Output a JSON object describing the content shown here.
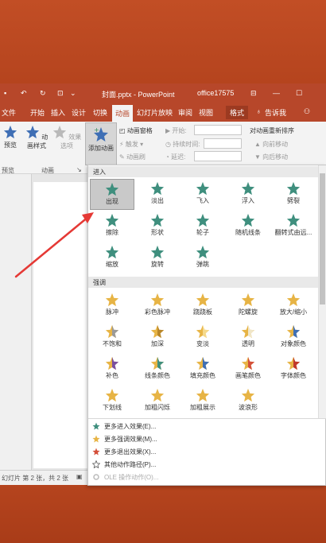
{
  "titlebar": {
    "file": "封面.pptx - PowerPoint",
    "account": "office17575"
  },
  "tabs": [
    "文件",
    "开始",
    "插入",
    "设计",
    "切换",
    "动画",
    "幻灯片放映",
    "审阅",
    "视图",
    "格式"
  ],
  "active_tab": "动画",
  "tell_me": "告诉我",
  "ribbon": {
    "preview": "预览",
    "animation_style": "动画样式",
    "effect_options": "效果选项",
    "add_animation": "添加动画",
    "animation_pane": "动画窗格",
    "trigger": "触发",
    "animation_painter": "动画刷",
    "start": "开始:",
    "duration": "持续时间:",
    "delay": "延迟:",
    "reorder": "对动画重新排序",
    "move_earlier": "向前移动",
    "move_later": "向后移动",
    "group_preview": "预览",
    "group_animation": "动画"
  },
  "gallery": {
    "entrance_header": "进入",
    "emphasis_header": "强调",
    "entrance": [
      "出现",
      "淡出",
      "飞入",
      "浮入",
      "劈裂",
      "擦除",
      "形状",
      "轮子",
      "随机线条",
      "翻转式由远...",
      "缩放",
      "旋转",
      "弹跳"
    ],
    "emphasis": [
      "脉冲",
      "彩色脉冲",
      "跷跷板",
      "陀螺旋",
      "放大/缩小",
      "不饱和",
      "加深",
      "变淡",
      "透明",
      "对象颜色",
      "补色",
      "线条颜色",
      "填充颜色",
      "画笔颜色",
      "字体颜色",
      "下划线",
      "加粗闪烁",
      "加粗展示",
      "波浪形"
    ],
    "more": [
      "更多进入效果(E)...",
      "更多强调效果(M)...",
      "更多退出效果(X)...",
      "其他动作路径(P)...",
      "OLE 操作动作(O)..."
    ]
  },
  "status": {
    "slide_info": "幻灯片 第 2 张，共 2 张"
  },
  "colors": {
    "accent": "#b7472a",
    "entrance_star": "#3f8f7e",
    "emphasis_star": "#e7b445",
    "exit_star": "#d4503a"
  }
}
